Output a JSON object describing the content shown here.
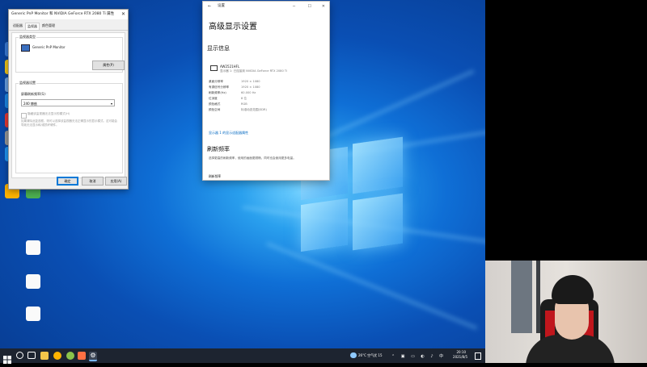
{
  "display_dialog": {
    "title": "Generic PnP Monitor 和 NVIDIA GeForce RTX 2080 Ti 属性",
    "close_glyph": "✕",
    "tabs": [
      "适配器",
      "监视器",
      "颜色管理"
    ],
    "type_group_title": "监视器类型",
    "monitor_name": "Generic PnP Monitor",
    "properties_button": "属性(P)",
    "settings_group_title": "监视器设置",
    "refresh_label": "屏幕刷新频率(S):",
    "refresh_value": "240 赫兹",
    "hide_modes_label": "隐藏该监视器无法显示的模式(H)",
    "hide_modes_desc": "如果清除此复选框，则可以选择该监视器无法正确显示的显示模式。这可能会导致无法显示和/或损坏硬件。",
    "ok_button": "确定",
    "cancel_button": "取消",
    "apply_button": "应用(A)"
  },
  "settings_window": {
    "app_title": "设置",
    "page_title": "高级显示设置",
    "section_display_info": "显示信息",
    "monitor_model": "AW2521HFL",
    "monitor_subtitle": "显示器 1: 已连接到 NVIDIA GeForce RTX 2080 Ti",
    "info_rows": [
      {
        "k": "桌面分辨率",
        "v": "1920 × 1080"
      },
      {
        "k": "有源信号分辨率",
        "v": "1920 × 1080"
      },
      {
        "k": "刷新频率(Hz)",
        "v": "60.000 Hz"
      },
      {
        "k": "位深度",
        "v": "8 位"
      },
      {
        "k": "颜色格式",
        "v": "RGB"
      },
      {
        "k": "颜色空间",
        "v": "标准动态范围(SDR)"
      }
    ],
    "adapter_link": "显示器 1 的显示适配器属性",
    "section_refresh": "刷新频率",
    "refresh_desc": "选择更高的刷新频率，使用的画面更顺畅，同时也会使用更多电量。",
    "refresh_footer": "刷新频率"
  },
  "desktop": {
    "icons": [
      {
        "label": "",
        "color": "#3a7bd5"
      },
      {
        "label": "",
        "color": "#f0c419"
      },
      {
        "label": "",
        "color": "#6aa0e0"
      },
      {
        "label": "",
        "color": "#1e88e5"
      },
      {
        "label": "",
        "color": "#e53935"
      },
      {
        "label": "",
        "color": "#999999"
      },
      {
        "label": "",
        "color": "#2196f3"
      },
      {
        "label": "",
        "color": "#4caf50"
      },
      {
        "label": "",
        "color": "#fafafa"
      },
      {
        "label": "",
        "color": "#fafafa"
      },
      {
        "label": "",
        "color": "#ffb300"
      },
      {
        "label": "",
        "color": "#fafafa"
      }
    ]
  },
  "taskbar": {
    "weather": "26°C 空气优 15",
    "time": "20:10",
    "date": "2021/8/5"
  }
}
